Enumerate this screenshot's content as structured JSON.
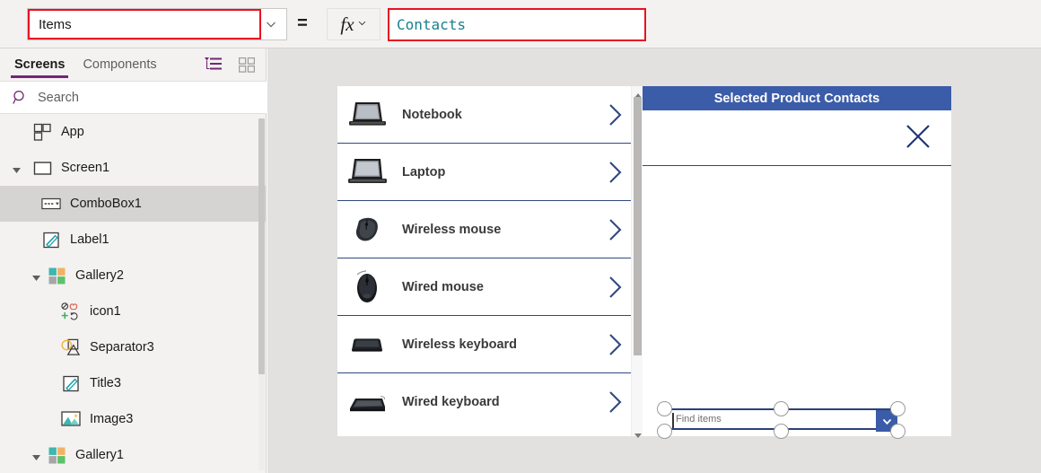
{
  "formula_bar": {
    "property_value": "Items",
    "property_chevron_icon": "chevron-down-icon",
    "equals": "=",
    "fx_label": "fx",
    "fx_chevron_icon": "chevron-down-icon",
    "formula_value": "Contacts",
    "highlight_color": "#e81123",
    "formula_text_color": "#17818e"
  },
  "sidebar": {
    "tabs": [
      {
        "label": "Screens",
        "active": true
      },
      {
        "label": "Components",
        "active": false
      }
    ],
    "tree_view_icon": "tree-view-icon",
    "grid_view_icon": "grid-view-icon",
    "accent_color": "#742774",
    "search": {
      "placeholder": "Search",
      "icon": "search-icon"
    },
    "tree": [
      {
        "label": "App",
        "icon": "app-icon",
        "indent": 0,
        "caret": "none",
        "selected": false
      },
      {
        "label": "Screen1",
        "icon": "screen-icon",
        "indent": 0,
        "caret": "expanded",
        "selected": false
      },
      {
        "label": "ComboBox1",
        "icon": "combobox-icon",
        "indent": 1,
        "caret": "none",
        "selected": true
      },
      {
        "label": "Label1",
        "icon": "label-icon",
        "indent": 1,
        "caret": "none",
        "selected": false
      },
      {
        "label": "Gallery2",
        "icon": "gallery-icon",
        "indent": 1,
        "caret": "expanded",
        "selected": false
      },
      {
        "label": "icon1",
        "icon": "icon-glyph-icon",
        "indent": 2,
        "caret": "none",
        "selected": false
      },
      {
        "label": "Separator3",
        "icon": "shapes-icon",
        "indent": 2,
        "caret": "none",
        "selected": false
      },
      {
        "label": "Title3",
        "icon": "label-icon",
        "indent": 2,
        "caret": "none",
        "selected": false
      },
      {
        "label": "Image3",
        "icon": "image-icon",
        "indent": 2,
        "caret": "none",
        "selected": false
      },
      {
        "label": "Gallery1",
        "icon": "gallery-icon",
        "indent": 1,
        "caret": "expanded",
        "selected": false
      }
    ]
  },
  "canvas": {
    "background_color": "#e2e1e0",
    "gallery": {
      "items": [
        {
          "label": "Notebook",
          "image": "notebook-image",
          "chevron_icon": "chevron-right-icon"
        },
        {
          "label": "Laptop",
          "image": "laptop-image",
          "chevron_icon": "chevron-right-icon"
        },
        {
          "label": "Wireless mouse",
          "image": "wireless-mouse-image",
          "chevron_icon": "chevron-right-icon"
        },
        {
          "label": "Wired mouse",
          "image": "wired-mouse-image",
          "chevron_icon": "chevron-right-icon"
        },
        {
          "label": "Wireless keyboard",
          "image": "wireless-keyboard-image",
          "chevron_icon": "chevron-right-icon"
        },
        {
          "label": "Wired keyboard",
          "image": "wired-keyboard-image",
          "chevron_icon": "chevron-right-icon"
        }
      ],
      "scrollbar": {
        "up_arrow_icon": "scroll-up-icon",
        "down_arrow_icon": "scroll-down-icon"
      }
    },
    "detail_panel": {
      "title": "Selected Product Contacts",
      "title_bar_color": "#3b5ca8",
      "close_icon": "close-icon"
    },
    "combobox": {
      "placeholder": "Find items",
      "dropdown_icon": "chevron-down-icon",
      "border_color": "#2b4179",
      "button_color": "#3b5ca8",
      "selected": true,
      "handles": [
        "resize-handle-top-left",
        "resize-handle-top-center",
        "resize-handle-top-right",
        "resize-handle-bottom-left",
        "resize-handle-bottom-center",
        "resize-handle-bottom-right"
      ]
    }
  }
}
